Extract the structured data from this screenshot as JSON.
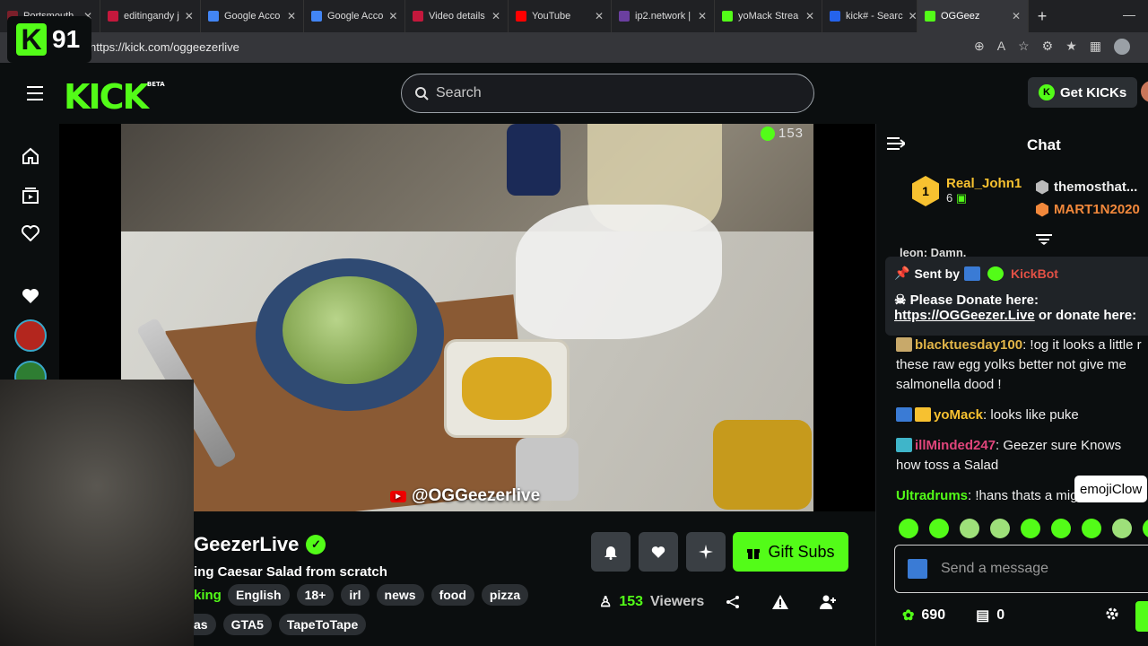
{
  "browser": {
    "tabs": [
      {
        "label": "Portsmouth",
        "color": "#7a1f2a"
      },
      {
        "label": "editingandy j",
        "color": "#c4183c"
      },
      {
        "label": "Google Acco",
        "color": "#4285f4"
      },
      {
        "label": "Google Acco",
        "color": "#4285f4"
      },
      {
        "label": "Video details",
        "color": "#c4183c"
      },
      {
        "label": "YouTube",
        "color": "#ff0000"
      },
      {
        "label": "ip2.network |",
        "color": "#6b3fa0"
      },
      {
        "label": "yoMack Strea",
        "color": "#53fc18"
      },
      {
        "label": "kick# - Searc",
        "color": "#2563eb"
      },
      {
        "label": "OGGeez",
        "color": "#53fc18"
      }
    ],
    "url": "https://kick.com/oggeezerlive"
  },
  "overlay_badge": {
    "letter": "K",
    "count": "91"
  },
  "header": {
    "logo": "KICK",
    "logo_sup": "BETA",
    "search_placeholder": "Search",
    "get_kicks": "Get KICKs"
  },
  "video": {
    "viewer_count": "153",
    "watermark": "@OGGeezerlive"
  },
  "stream": {
    "streamer": "GeezerLive",
    "title": "ing Caesar Salad from scratch",
    "category": "king",
    "tags_row1": [
      "English",
      "18+",
      "irl",
      "news",
      "food",
      "pizza"
    ],
    "tags_row2": [
      "as",
      "GTA5",
      "TapeToTape"
    ],
    "gift_subs": "Gift Subs",
    "viewers_num": "153",
    "viewers_label": "Viewers"
  },
  "chat": {
    "title": "Chat",
    "leader": {
      "rank": "1",
      "name": "Real_John1",
      "sub": "6"
    },
    "leader_right": [
      "themosthat...",
      "MART1N2020"
    ],
    "partial_msg": "leon: Damn.",
    "pinned": {
      "sent_by": "Sent by",
      "bot": "KickBot",
      "line1": "Please Donate here:",
      "link": "https://OGGeezer.Live",
      "line2": " or donate here:"
    },
    "messages": [
      {
        "user": "blacktuesday100",
        "color": "#e2b548",
        "text": ": !og it looks a little r these raw egg yolks better not give me salmonella dood !"
      },
      {
        "user": "yoMack",
        "color": "#f7c130",
        "text": ": looks like puke"
      },
      {
        "user": "illMinded247",
        "color": "#e0457b",
        "text": ": Geezer sure Knows how toss a Salad"
      },
      {
        "user": "Ultradrums",
        "color": "#53fc18",
        "text": ": !hans thats a mig"
      }
    ],
    "tooltip": "emojiClow",
    "input_placeholder": "Send a message",
    "points": "690",
    "drops": "0"
  }
}
